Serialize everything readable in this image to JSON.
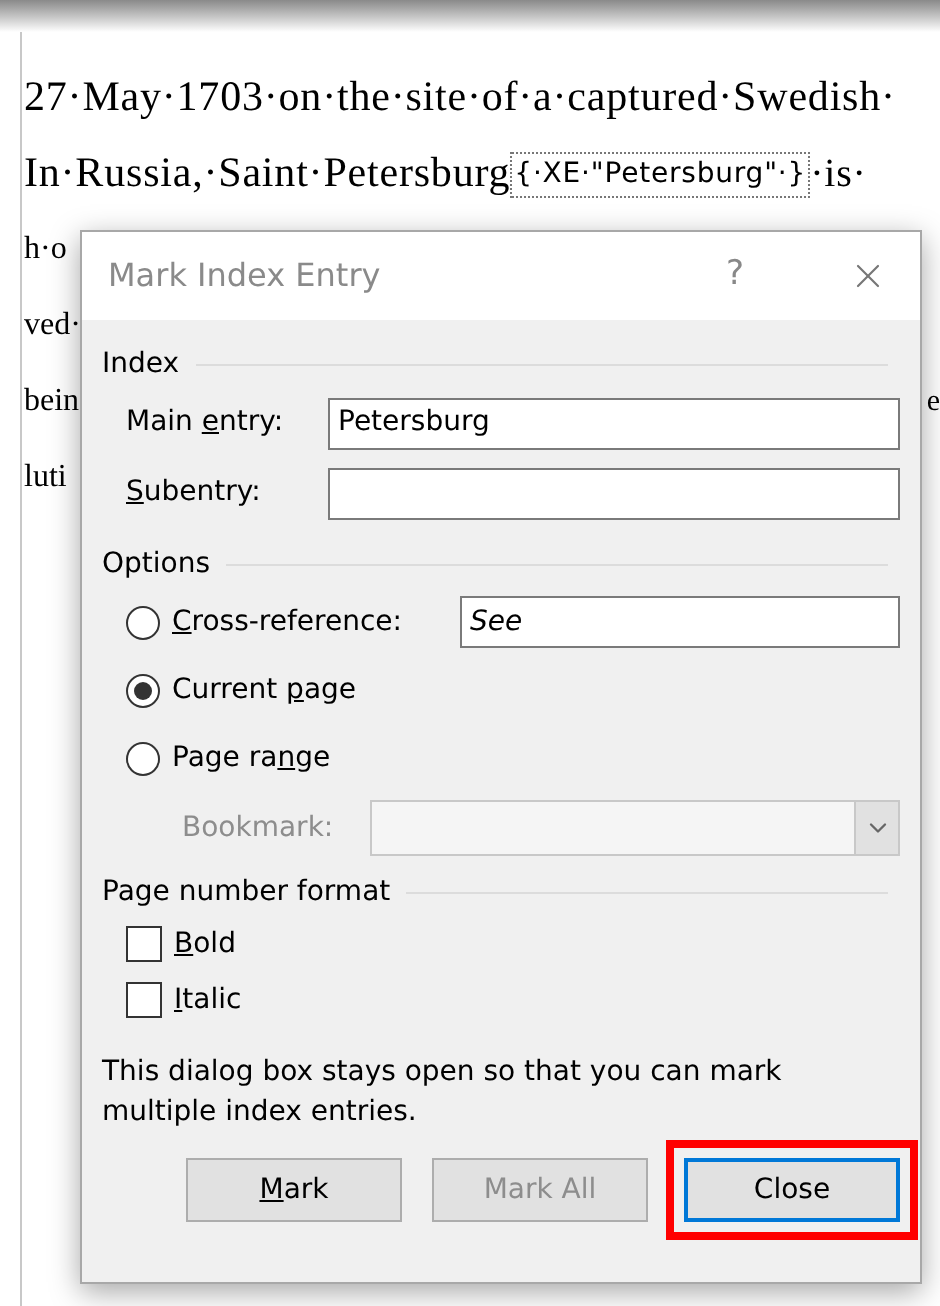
{
  "document": {
    "lines": [
      {
        "left": "27·May·1703·on·the·site·of·a·captured·Swedish·"
      },
      {
        "left": "In·Russia,·Saint·Petersburg",
        "field": "{·XE·\"Petersburg\"·}",
        "after": "·is·"
      },
      {
        "left": "h·o"
      },
      {
        "left": "ved·"
      },
      {
        "left": "bein",
        "right": "e"
      },
      {
        "left": "luti"
      }
    ]
  },
  "dialog": {
    "title": "Mark Index Entry",
    "help": "?",
    "index": {
      "heading": "Index",
      "fields": [
        {
          "label_pre": "Main ",
          "access_key": "e",
          "label_post": "ntry:",
          "value": "Petersburg"
        },
        {
          "access_key": "S",
          "label_post": "ubentry:"
        }
      ]
    },
    "options": {
      "heading": "Options",
      "radios": [
        {
          "access_key": "C",
          "label_post": "ross-reference:",
          "selected": false,
          "kind": "field",
          "value": "See"
        },
        {
          "label_pre": "Current ",
          "access_key": "p",
          "label_post": "age",
          "selected": true,
          "kind": "plain"
        },
        {
          "label_pre": "Page ra",
          "access_key": "n",
          "label_post": "ge",
          "selected": false,
          "kind": "plain"
        }
      ],
      "bookmark": {
        "label": "Bookmark:",
        "disabled": true
      }
    },
    "page_number_format": {
      "heading": "Page number format",
      "checkboxes": [
        {
          "access_key": "B",
          "label_post": "old",
          "checked": false
        },
        {
          "access_key": "I",
          "label_post": "talic",
          "checked": false
        }
      ]
    },
    "note": "This dialog box stays open so that you can mark multiple index entries.",
    "buttons": [
      {
        "access_key": "M",
        "label_post": "ark",
        "disabled": false,
        "default": false,
        "highlighted": false
      },
      {
        "label_pre": "Mark All",
        "disabled": true,
        "default": false,
        "highlighted": false
      },
      {
        "label_pre": "Close",
        "disabled": false,
        "default": true,
        "highlighted": true
      }
    ]
  }
}
